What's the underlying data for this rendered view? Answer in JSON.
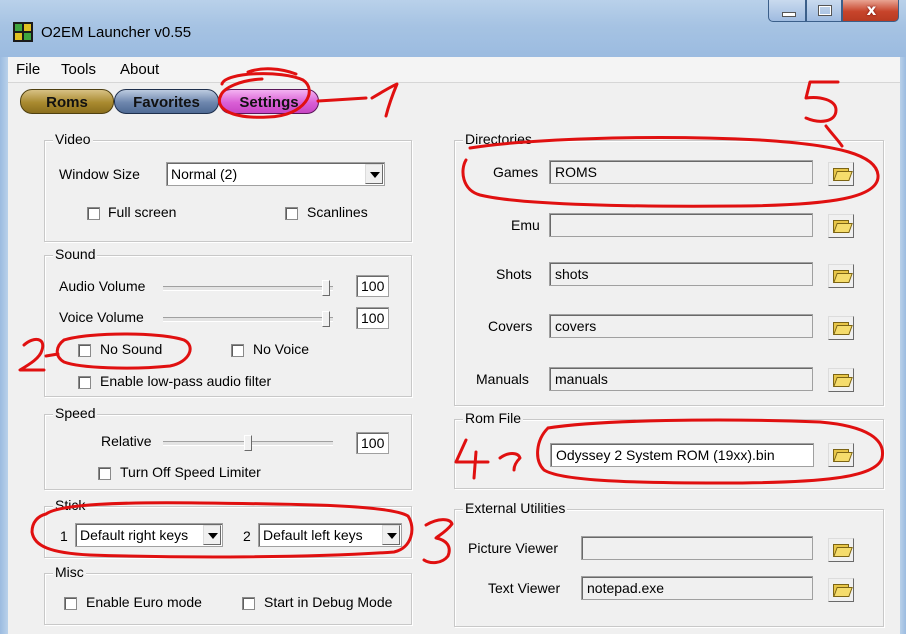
{
  "window": {
    "title": "O2EM Launcher v0.55",
    "close_glyph": "x",
    "accent_color": "#9bbbe0"
  },
  "menu": {
    "items": [
      "File",
      "Tools",
      "About"
    ]
  },
  "tabs": {
    "roms": "Roms",
    "favorites": "Favorites",
    "settings": "Settings"
  },
  "video": {
    "legend": "Video",
    "window_size_label": "Window Size",
    "window_size_value": "Normal (2)",
    "fullscreen_label": "Full screen",
    "scanlines_label": "Scanlines"
  },
  "sound": {
    "legend": "Sound",
    "audio_label": "Audio Volume",
    "audio_value": "100",
    "voice_label": "Voice Volume",
    "voice_value": "100",
    "nosound_label": "No Sound",
    "novoice_label": "No Voice",
    "lowpass_label": "Enable low-pass audio filter"
  },
  "speed": {
    "legend": "Speed",
    "relative_label": "Relative",
    "relative_value": "100",
    "limiter_label": "Turn Off Speed Limiter"
  },
  "stick": {
    "legend": "Stick",
    "stick1_num": "1",
    "stick1_value": "Default right keys",
    "stick2_num": "2",
    "stick2_value": "Default left keys"
  },
  "misc": {
    "legend": "Misc",
    "euro_label": "Enable Euro mode",
    "debug_label": "Start in Debug Mode"
  },
  "directories": {
    "legend": "Directories",
    "rows": [
      {
        "label": "Games",
        "value": "ROMS"
      },
      {
        "label": "Emu",
        "value": ""
      },
      {
        "label": "Shots",
        "value": "shots"
      },
      {
        "label": "Covers",
        "value": "covers"
      },
      {
        "label": "Manuals",
        "value": "manuals"
      }
    ]
  },
  "romfile": {
    "legend": "Rom File",
    "value": "Odyssey 2 System ROM (19xx).bin"
  },
  "utilities": {
    "legend": "External Utilities",
    "picture_label": "Picture Viewer",
    "picture_value": "",
    "text_label": "Text Viewer",
    "text_value": "notepad.exe"
  },
  "annotations": {
    "color": "#e01010",
    "marks": [
      "1",
      "2",
      "3",
      "4",
      "5"
    ]
  },
  "icons": {
    "app": "o2em-app-icon",
    "browse": "folder-open-icon",
    "dropdown": "chevron-down-icon",
    "minimize": "minimize-icon",
    "maximize": "maximize-icon",
    "close": "close-icon"
  }
}
